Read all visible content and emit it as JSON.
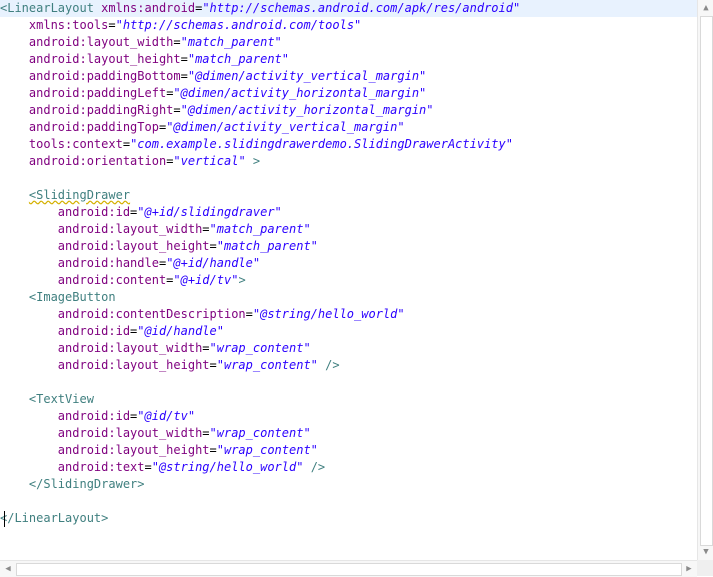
{
  "editor": {
    "lines": [
      {
        "t": "tag",
        "v": "<LinearLayout"
      },
      {
        "t": "attr",
        "v": "xmlns:android"
      },
      {
        "t": "val",
        "v": "\"http://schemas.android.com/apk/res/android\""
      },
      {
        "t": "attr",
        "v": "xmlns:tools"
      },
      {
        "t": "val",
        "v": "\"http://schemas.android.com/tools\""
      },
      {
        "t": "attr",
        "v": "android:layout_width"
      },
      {
        "t": "val",
        "v": "\"match_parent\""
      },
      {
        "t": "attr",
        "v": "android:layout_height"
      },
      {
        "t": "val",
        "v": "\"match_parent\""
      },
      {
        "t": "attr",
        "v": "android:paddingBottom"
      },
      {
        "t": "val",
        "v": "\"@dimen/activity_vertical_margin\""
      },
      {
        "t": "attr",
        "v": "android:paddingLeft"
      },
      {
        "t": "val",
        "v": "\"@dimen/activity_horizontal_margin\""
      },
      {
        "t": "attr",
        "v": "android:paddingRight"
      },
      {
        "t": "val",
        "v": "\"@dimen/activity_horizontal_margin\""
      },
      {
        "t": "attr",
        "v": "android:paddingTop"
      },
      {
        "t": "val",
        "v": "\"@dimen/activity_vertical_margin\""
      },
      {
        "t": "attr",
        "v": "tools:context"
      },
      {
        "t": "val",
        "v": "\"com.example.slidingdrawerdemo.SlidingDrawerActivity\""
      },
      {
        "t": "attr",
        "v": "android:orientation"
      },
      {
        "t": "val",
        "v": "\"vertical\""
      },
      {
        "t": "tag",
        "v": ">"
      },
      {
        "t": "tag",
        "v": "<SlidingDrawer"
      },
      {
        "t": "attr",
        "v": "android:id"
      },
      {
        "t": "val",
        "v": "\"@+id/slidingdraver\""
      },
      {
        "t": "attr",
        "v": "android:layout_width"
      },
      {
        "t": "val",
        "v": "\"match_parent\""
      },
      {
        "t": "attr",
        "v": "android:layout_height"
      },
      {
        "t": "val",
        "v": "\"match_parent\""
      },
      {
        "t": "attr",
        "v": "android:handle"
      },
      {
        "t": "val",
        "v": "\"@+id/handle\""
      },
      {
        "t": "attr",
        "v": "android:content"
      },
      {
        "t": "val",
        "v": "\"@+id/tv\""
      },
      {
        "t": "tag",
        "v": ">"
      },
      {
        "t": "tag",
        "v": "<ImageButton"
      },
      {
        "t": "attr",
        "v": "android:contentDescription"
      },
      {
        "t": "val",
        "v": "\"@string/hello_world\""
      },
      {
        "t": "attr",
        "v": "android:id"
      },
      {
        "t": "val",
        "v": "\"@id/handle\""
      },
      {
        "t": "attr",
        "v": "android:layout_width"
      },
      {
        "t": "val",
        "v": "\"wrap_content\""
      },
      {
        "t": "attr",
        "v": "android:layout_height"
      },
      {
        "t": "val",
        "v": "\"wrap_content\""
      },
      {
        "t": "tag",
        "v": "/>"
      },
      {
        "t": "tag",
        "v": "<TextView"
      },
      {
        "t": "attr",
        "v": "android:id"
      },
      {
        "t": "val",
        "v": "\"@id/tv\""
      },
      {
        "t": "attr",
        "v": "android:layout_width"
      },
      {
        "t": "val",
        "v": "\"wrap_content\""
      },
      {
        "t": "attr",
        "v": "android:layout_height"
      },
      {
        "t": "val",
        "v": "\"wrap_content\""
      },
      {
        "t": "attr",
        "v": "android:text"
      },
      {
        "t": "val",
        "v": "\"@string/hello_world\""
      },
      {
        "t": "tag",
        "v": "/>"
      },
      {
        "t": "tag",
        "v": "</SlidingDrawer>"
      },
      {
        "t": "tag",
        "v": "</LinearLayout>"
      }
    ]
  },
  "scrollbars": {
    "up_arrow": "▲",
    "down_arrow": "▼",
    "left_arrow": "◀",
    "right_arrow": "▶"
  },
  "colors": {
    "tag": "#3f7f7f",
    "attr": "#7f007f",
    "value": "#2a00ff",
    "current_line": "#e8f2fe"
  }
}
